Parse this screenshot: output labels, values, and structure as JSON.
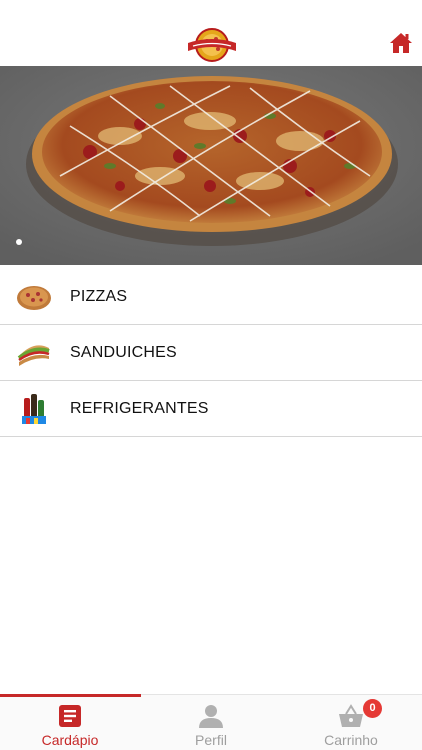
{
  "header": {
    "logo_text": "Sabor Caseiro",
    "home_icon": "home-icon"
  },
  "banner": {
    "image": "pizza-banner",
    "slide_count": 1,
    "active_slide": 1
  },
  "menu": {
    "items": [
      {
        "label": "PIZZAS",
        "icon": "pizza-thumbnail"
      },
      {
        "label": "SANDUICHES",
        "icon": "sandwich-thumbnail"
      },
      {
        "label": "REFRIGERANTES",
        "icon": "soda-thumbnail"
      }
    ]
  },
  "bottom_nav": {
    "items": [
      {
        "label": "Cardápio",
        "icon": "menu-icon",
        "active": true
      },
      {
        "label": "Perfil",
        "icon": "person-icon",
        "active": false
      },
      {
        "label": "Carrinho",
        "icon": "basket-icon",
        "active": false,
        "badge": "0"
      }
    ]
  },
  "colors": {
    "accent": "#c62828",
    "badge": "#e53935",
    "inactive": "#9e9e9e",
    "banner_bg": "#6d6d6d"
  }
}
